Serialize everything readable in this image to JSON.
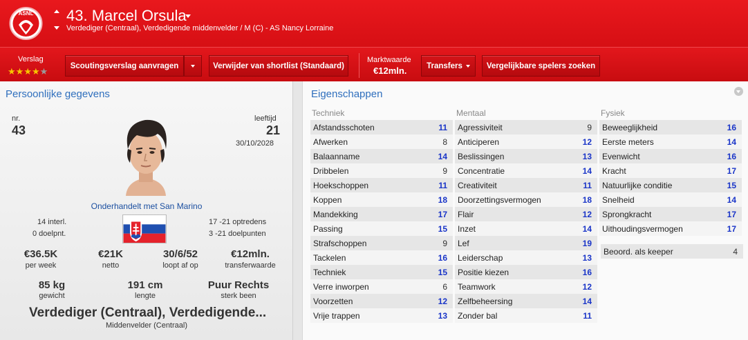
{
  "header": {
    "name": "43. Marcel Orsula",
    "subtitle": "Verdediger (Centraal), Verdedigende middenvelder / M (C) - AS Nancy Lorraine",
    "crest_text": "ASNL",
    "brand_color": "#e01318"
  },
  "toolbar": {
    "verslag_label": "Verslag",
    "stars": 4,
    "stars_max": 5,
    "btn_scouting": "Scoutingsverslag aanvragen",
    "btn_remove_shortlist": "Verwijder van shortlist (Standaard)",
    "marktwaarde_label": "Marktwaarde",
    "marktwaarde_value": "€12mln.",
    "btn_transfers": "Transfers",
    "btn_similar": "Vergelijkbare spelers zoeken"
  },
  "personal": {
    "title": "Persoonlijke gegevens",
    "nr_label": "nr.",
    "nr_value": "43",
    "age_label": "leeftijd",
    "age_value": "21",
    "dob": "30/10/2028",
    "nat_status": "Onderhandelt met San Marino",
    "intl_caps": "14 interl.",
    "intl_goals": "0 doelpnt.",
    "u21_apps": "17 -21 optredens",
    "u21_goals": "3 -21 doelpunten",
    "wage": "€36.5K",
    "wage_label": "per week",
    "net": "€21K",
    "net_label": "netto",
    "contract": "30/6/52",
    "contract_label": "loopt af op",
    "transfer_value": "€12mln.",
    "transfer_label": "transferwaarde",
    "weight": "85 kg",
    "weight_label": "gewicht",
    "height": "191 cm",
    "height_label": "lengte",
    "foot": "Puur Rechts",
    "foot_label": "sterk been",
    "positions_long": "Verdediger (Centraal), Verdedigende...",
    "position_short": "Middenvelder (Centraal)"
  },
  "attributes": {
    "title": "Eigenschappen",
    "techniek_label": "Techniek",
    "mentaal_label": "Mentaal",
    "fysiek_label": "Fysiek",
    "techniek": [
      {
        "name": "Afstandsschoten",
        "value": "11"
      },
      {
        "name": "Afwerken",
        "value": "8"
      },
      {
        "name": "Balaanname",
        "value": "14"
      },
      {
        "name": "Dribbelen",
        "value": "9"
      },
      {
        "name": "Hoekschoppen",
        "value": "11"
      },
      {
        "name": "Koppen",
        "value": "18"
      },
      {
        "name": "Mandekking",
        "value": "17"
      },
      {
        "name": "Passing",
        "value": "15"
      },
      {
        "name": "Strafschoppen",
        "value": "9"
      },
      {
        "name": "Tackelen",
        "value": "16"
      },
      {
        "name": "Techniek",
        "value": "15"
      },
      {
        "name": "Verre inworpen",
        "value": "6"
      },
      {
        "name": "Voorzetten",
        "value": "12"
      },
      {
        "name": "Vrije trappen",
        "value": "13"
      }
    ],
    "mentaal": [
      {
        "name": "Agressiviteit",
        "value": "9"
      },
      {
        "name": "Anticiperen",
        "value": "12"
      },
      {
        "name": "Beslissingen",
        "value": "13"
      },
      {
        "name": "Concentratie",
        "value": "14"
      },
      {
        "name": "Creativiteit",
        "value": "11"
      },
      {
        "name": "Doorzettingsvermogen",
        "value": "18"
      },
      {
        "name": "Flair",
        "value": "12"
      },
      {
        "name": "Inzet",
        "value": "14"
      },
      {
        "name": "Lef",
        "value": "19"
      },
      {
        "name": "Leiderschap",
        "value": "13"
      },
      {
        "name": "Positie kiezen",
        "value": "16"
      },
      {
        "name": "Teamwork",
        "value": "12"
      },
      {
        "name": "Zelfbeheersing",
        "value": "14"
      },
      {
        "name": "Zonder bal",
        "value": "11"
      }
    ],
    "fysiek": [
      {
        "name": "Beweeglijkheid",
        "value": "16"
      },
      {
        "name": "Eerste meters",
        "value": "14"
      },
      {
        "name": "Evenwicht",
        "value": "16"
      },
      {
        "name": "Kracht",
        "value": "17"
      },
      {
        "name": "Natuurlijke conditie",
        "value": "15"
      },
      {
        "name": "Snelheid",
        "value": "14"
      },
      {
        "name": "Sprongkracht",
        "value": "17"
      },
      {
        "name": "Uithoudingsvermogen",
        "value": "17"
      }
    ],
    "keeper_label": "Beoord. als keeper",
    "keeper_value": "4"
  }
}
